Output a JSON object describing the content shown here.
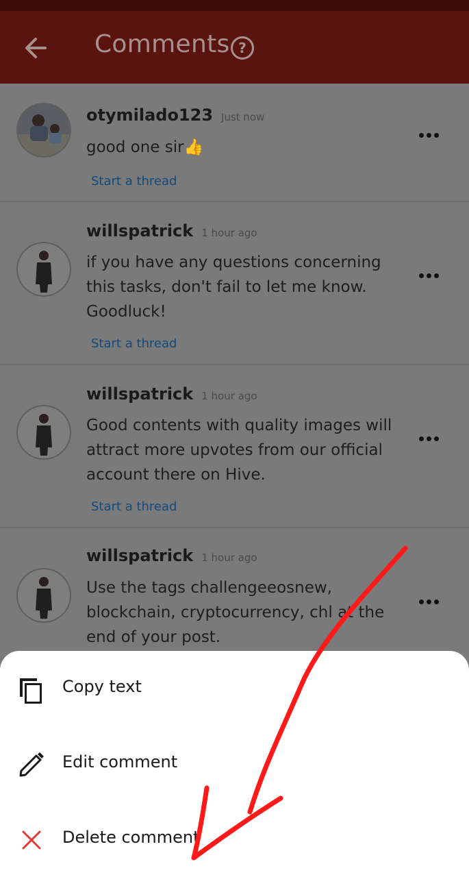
{
  "header": {
    "title": "Comments"
  },
  "comments": [
    {
      "username": "otymilado123",
      "timestamp": "Just now",
      "text": "good one sir👍",
      "thread_link": "Start a thread"
    },
    {
      "username": "willspatrick",
      "timestamp": "1 hour ago",
      "text": "if you have any questions concerning this tasks, don't fail to let me know. Goodluck!",
      "thread_link": "Start a thread"
    },
    {
      "username": "willspatrick",
      "timestamp": "1 hour ago",
      "text": "Good contents with quality images will attract more upvotes from our official account there on Hive.",
      "thread_link": "Start a thread"
    },
    {
      "username": "willspatrick",
      "timestamp": "1 hour ago",
      "text": "Use the tags challengeeosnew, blockchain, cryptocurrency, chl at the end of your post."
    }
  ],
  "sheet": {
    "items": [
      {
        "label": "Copy text",
        "icon": "copy-icon"
      },
      {
        "label": "Edit comment",
        "icon": "pencil-icon"
      },
      {
        "label": "Delete comment",
        "icon": "close-icon"
      }
    ]
  },
  "colors": {
    "header_bg": "#5a1410",
    "overlay": "#7a7a7a",
    "link": "#144a7a",
    "delete_icon": "#e53935",
    "annotation": "#ff1a1a"
  }
}
